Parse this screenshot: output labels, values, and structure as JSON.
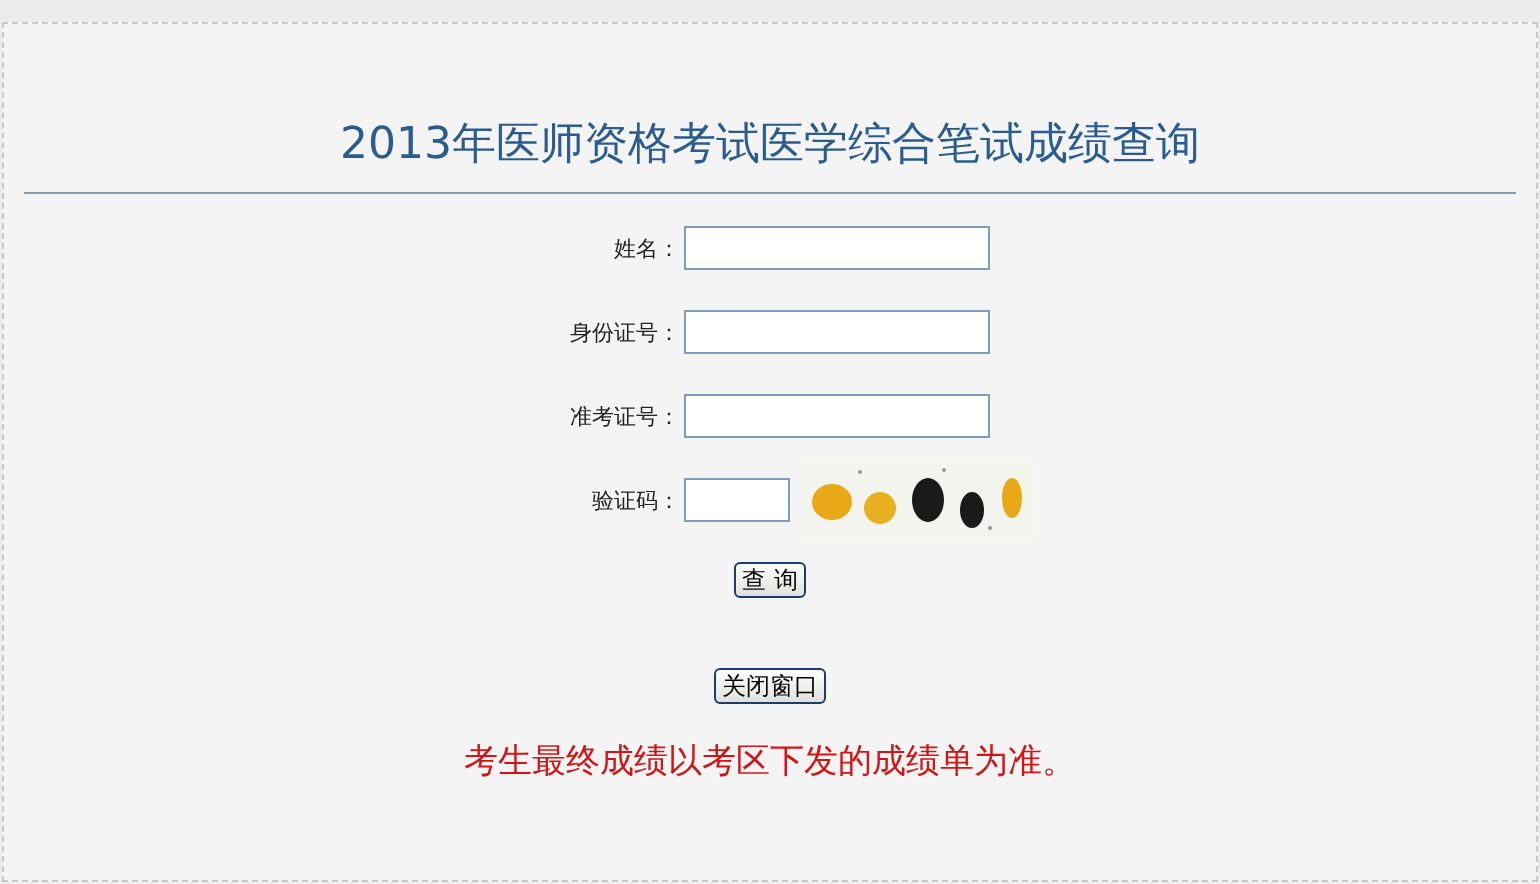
{
  "title": "2013年医师资格考试医学综合笔试成绩查询",
  "fields": [
    {
      "label": "姓名：",
      "kind": "text"
    },
    {
      "label": "身份证号：",
      "kind": "text"
    },
    {
      "label": "准考证号：",
      "kind": "text"
    },
    {
      "label": "验证码：",
      "kind": "captcha"
    }
  ],
  "buttons": [
    "查 询",
    "关闭窗口"
  ],
  "notice": "考生最终成绩以考区下发的成绩单为准。"
}
